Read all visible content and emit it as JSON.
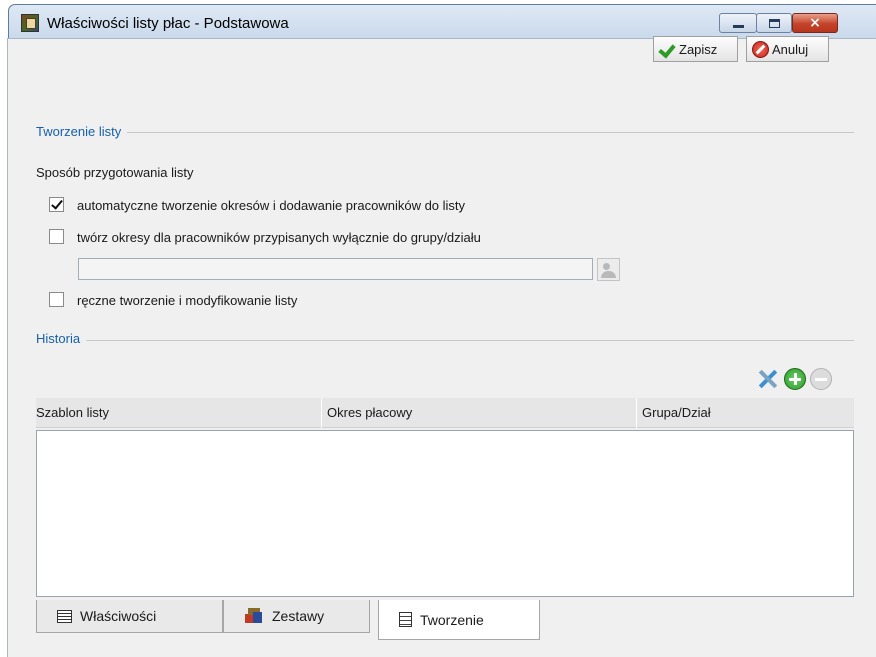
{
  "window": {
    "title": "Właściwości listy płac - Podstawowa",
    "close_glyph": "×"
  },
  "toolbar": {
    "save_label": "Zapisz",
    "cancel_label": "Anuluj"
  },
  "creation": {
    "section_title": "Tworzenie listy",
    "method_label": "Sposób przygotowania listy",
    "options": [
      {
        "label": "automatyczne tworzenie okresów i dodawanie pracowników do listy",
        "checked": true
      },
      {
        "label": "twórz okresy dla pracowników przypisanych wyłącznie do grupy/działu",
        "checked": false
      },
      {
        "label": "ręczne tworzenie i modyfikowanie listy",
        "checked": false
      }
    ],
    "group_input_value": ""
  },
  "history": {
    "section_title": "Historia",
    "columns": [
      "Szablon listy",
      "Okres płacowy",
      "Grupa/Dział"
    ],
    "rows": []
  },
  "tabs": [
    {
      "label": "Właściwości",
      "icon": "properties-icon",
      "active": false
    },
    {
      "label": "Zestawy",
      "icon": "sets-icon",
      "active": false
    },
    {
      "label": "Tworzenie",
      "icon": "document-icon",
      "active": true
    }
  ]
}
